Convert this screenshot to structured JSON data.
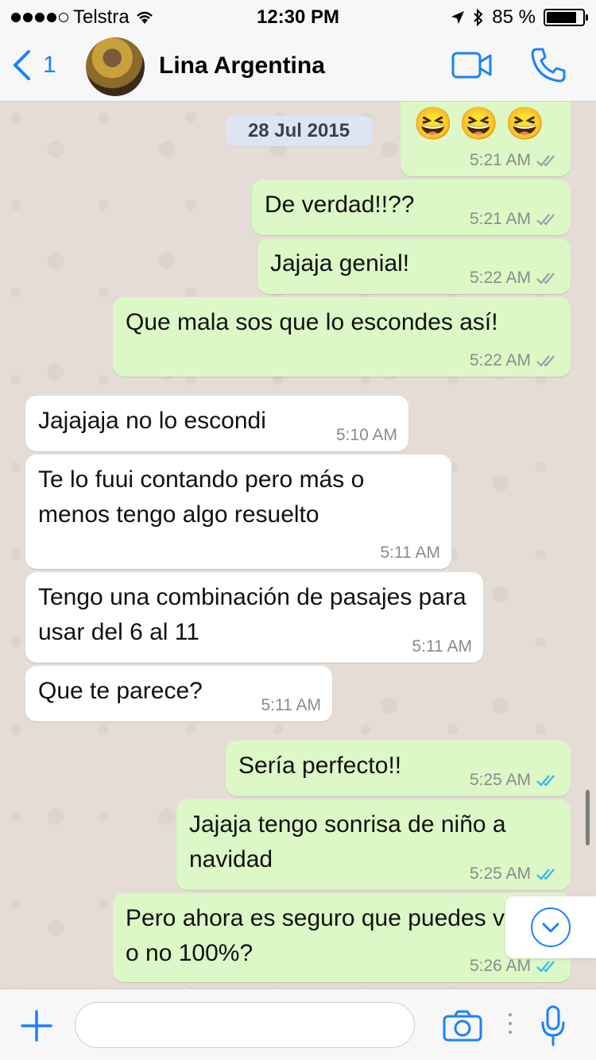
{
  "status_bar": {
    "carrier": "Telstra",
    "time": "12:30 PM",
    "battery_label": "85 %",
    "battery_level": 0.85
  },
  "header": {
    "back_count": "1",
    "contact_name": "Lina Argentina",
    "icons": [
      "back-chevron-icon",
      "video-call-icon",
      "phone-call-icon"
    ]
  },
  "chat": {
    "date_label": "28 Jul 2015",
    "emoji_row": "😆😆😆",
    "messages": [
      {
        "dir": "out",
        "text": "",
        "time": "5:21 AM",
        "status": "read"
      },
      {
        "dir": "out",
        "text": "De verdad!!??",
        "time": "5:21 AM",
        "status": "read"
      },
      {
        "dir": "out",
        "text": "Jajaja genial!",
        "time": "5:22 AM",
        "status": "read"
      },
      {
        "dir": "out",
        "text": "Que mala sos que lo escondes así!",
        "time": "5:22 AM",
        "status": "read"
      },
      {
        "dir": "in",
        "text": "Jajajaja no lo escondi",
        "time": "5:10 AM"
      },
      {
        "dir": "in",
        "text": "Te lo fuui contando pero más o menos tengo algo resuelto",
        "time": "5:11 AM"
      },
      {
        "dir": "in",
        "text": "Tengo una combinación de pasajes para usar del 6 al 11",
        "time": "5:11 AM"
      },
      {
        "dir": "in",
        "text": "Que te parece?",
        "time": "5:11 AM"
      },
      {
        "dir": "out",
        "text": "Sería perfecto!!",
        "time": "5:25 AM",
        "status": "delivered"
      },
      {
        "dir": "out",
        "text": "Jajaja tengo sonrisa de niño a navidad",
        "time": "5:25 AM",
        "status": "delivered"
      },
      {
        "dir": "out",
        "text": "Pero ahora es seguro que puedes venir o no 100%?",
        "time": "5:26 AM",
        "status": "delivered"
      }
    ]
  },
  "composer": {
    "input_value": "",
    "icons": [
      "plus-icon",
      "camera-icon",
      "microphone-icon"
    ]
  },
  "colors": {
    "accent": "#1a82fb",
    "outgoing_bubble": "#dcf8c6",
    "incoming_bubble": "#ffffff",
    "read_ticks": "#34b7f1",
    "delivered_ticks": "#9aa0a6",
    "date_pill": "#dde4f2"
  }
}
